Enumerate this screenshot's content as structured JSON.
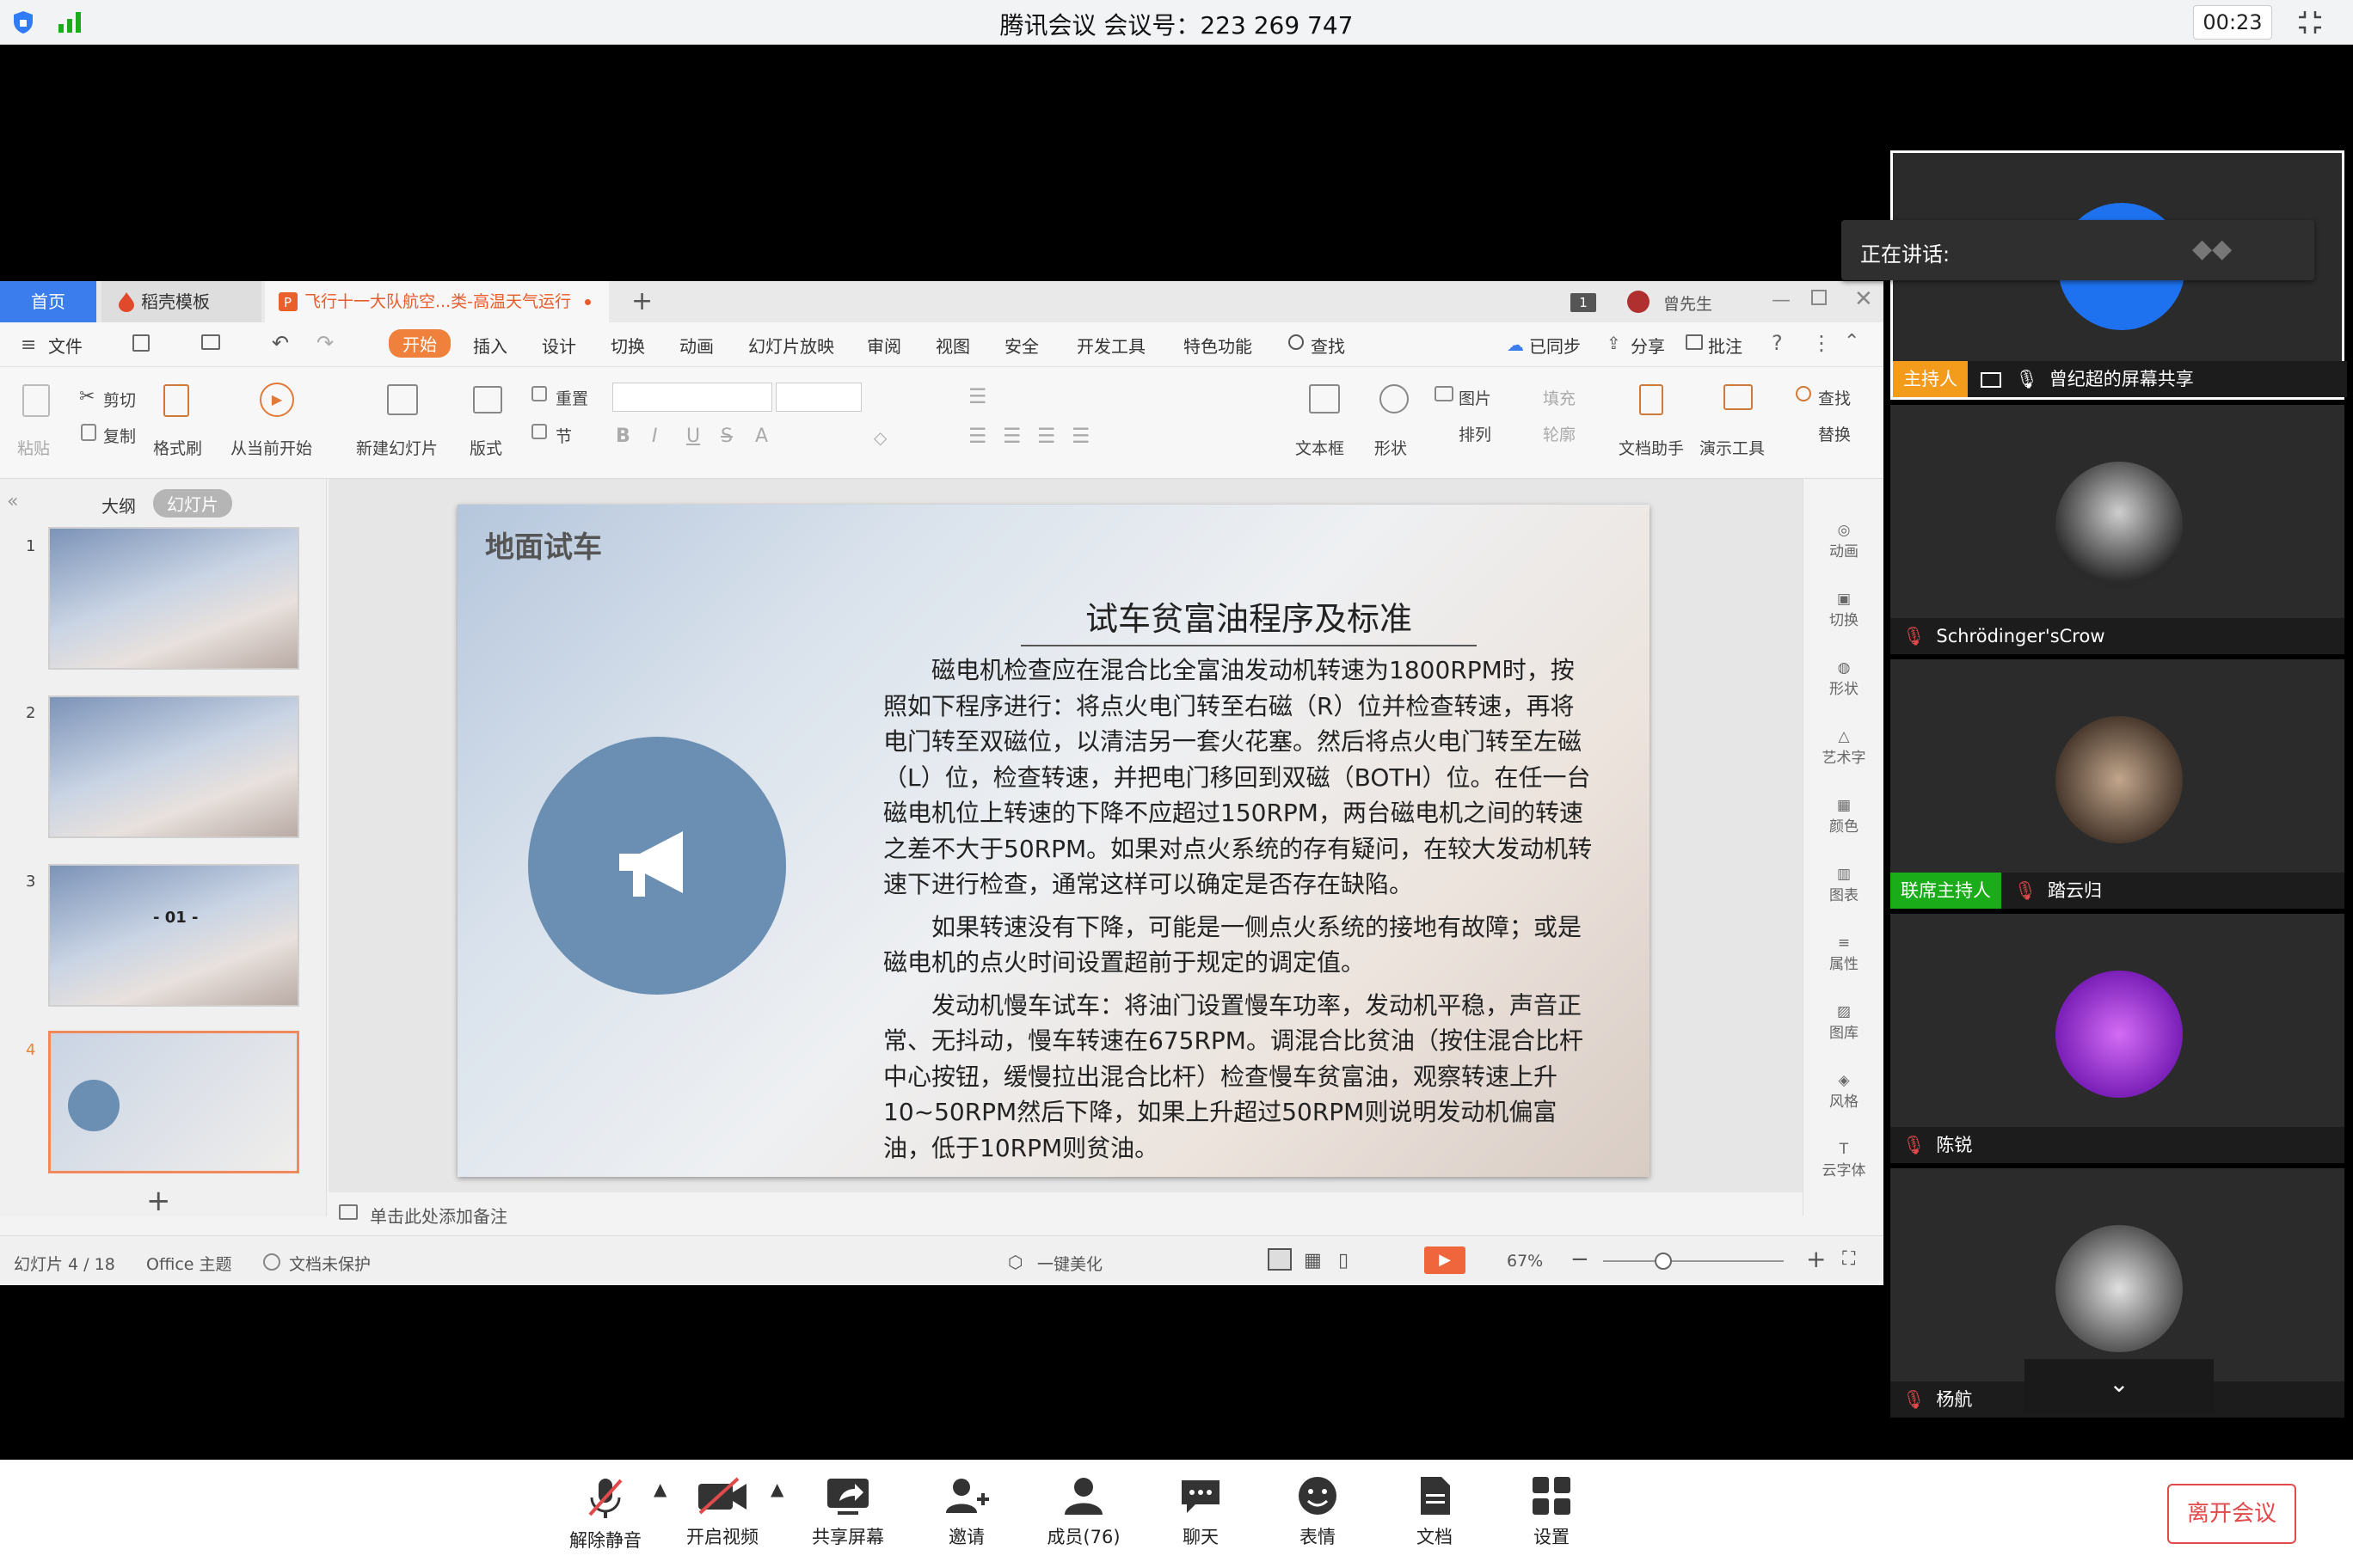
{
  "topbar": {
    "title": "腾讯会议 会议号：223 269 747",
    "timer": "00:23"
  },
  "wps": {
    "tabs": {
      "home": "首页",
      "template": "稻壳模板",
      "doc": "飞行十一大队航空...类-高温天气运行",
      "badge": "1",
      "user": "曾先生"
    },
    "menus": [
      "文件",
      "开始",
      "插入",
      "设计",
      "切换",
      "动画",
      "幻灯片放映",
      "审阅",
      "视图",
      "安全",
      "开发工具",
      "特色功能",
      "查找"
    ],
    "menu_right": {
      "sync": "已同步",
      "share": "分享",
      "comment": "批注"
    },
    "ribbon": {
      "paste": "粘贴",
      "cut": "剪切",
      "copy": "复制",
      "format_painter": "格式刷",
      "from_start": "从当前开始",
      "new_slide": "新建幻灯片",
      "layout": "版式",
      "reset": "重置",
      "section": "节",
      "textbox": "文本框",
      "shape": "形状",
      "picture": "图片",
      "fill": "填充",
      "arrange": "排列",
      "outline": "轮廓",
      "doc_helper": "文档助手",
      "present_tool": "演示工具",
      "find": "查找",
      "replace": "替换"
    },
    "leftpane": {
      "outline_tab": "大纲",
      "slides_tab": "幻灯片",
      "slide_numbers": [
        "1",
        "2",
        "3",
        "4"
      ],
      "thumb3_label": "- 01 -"
    },
    "slide": {
      "title": "地面试车",
      "content_title": "试车贫富油程序及标准",
      "paragraphs": [
        "磁电机检查应在混合比全富油发动机转速为1800RPM时，按照如下程序进行：将点火电门转至右磁（R）位并检查转速，再将电门转至双磁位，以清洁另一套火花塞。然后将点火电门转至左磁（L）位，检查转速，并把电门移回到双磁（BOTH）位。在任一台磁电机位上转速的下降不应超过150RPM，两台磁电机之间的转速之差不大于50RPM。如果对点火系统的存有疑问，在较大发动机转速下进行检查，通常这样可以确定是否存在缺陷。",
        "如果转速没有下降，可能是一侧点火系统的接地有故障；或是磁电机的点火时间设置超前于规定的调定值。",
        "发动机慢车试车：将油门设置慢车功率，发动机平稳，声音正常、无抖动，慢车转速在675RPM。调混合比贫油（按住混合比杆中心按钮，缓慢拉出混合比杆）检查慢车贫富油，观察转速上升10~50RPM然后下降，如果上升超过50RPM则说明发动机偏富油，低于10RPM则贫油。"
      ]
    },
    "notes_placeholder": "单击此处添加备注",
    "rightrail": [
      "动画",
      "切换",
      "形状",
      "艺术字",
      "颜色",
      "图表",
      "属性",
      "图库",
      "风格",
      "云字体"
    ],
    "status": {
      "slide_count": "幻灯片 4 / 18",
      "theme": "Office 主题",
      "protect": "文档未保护",
      "beautify": "一键美化",
      "zoom": "67%"
    }
  },
  "participants": {
    "speaking": "正在讲话:",
    "host_badge": "主持人",
    "cohost_badge": "联席主持人",
    "items": [
      {
        "name": "曾纪超的屏幕共享"
      },
      {
        "name": "Schrödinger'sCrow"
      },
      {
        "name": "踏云归"
      },
      {
        "name": "陈锐"
      },
      {
        "name": "杨航"
      }
    ]
  },
  "toolbar": {
    "unmute": "解除静音",
    "video": "开启视频",
    "share": "共享屏幕",
    "invite": "邀请",
    "members": "成员(76)",
    "chat": "聊天",
    "emoji": "表情",
    "docs": "文档",
    "settings": "设置",
    "leave": "离开会议"
  },
  "colors": {
    "accent_blue": "#3b7ded",
    "host_orange": "#f39c1c",
    "cohost_green": "#1aad19",
    "leave_red": "#e04a4a",
    "wps_orange": "#f0813c"
  }
}
